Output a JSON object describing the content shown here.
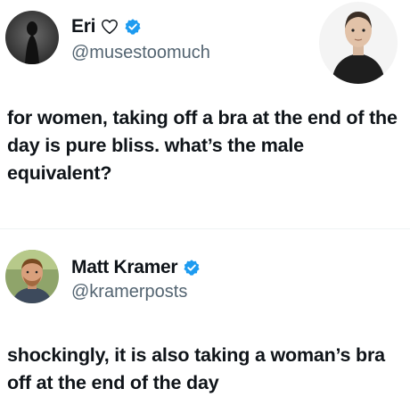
{
  "colors": {
    "verified": "#1d9bf0",
    "text": "#0f1419",
    "handle": "#536471"
  },
  "tweets": [
    {
      "display_name": "Eri",
      "name_icon": "heart-outline-icon",
      "verified_icon": "verified-badge-icon",
      "handle": "@musestoomuch",
      "text": "for women, taking off a bra at the end of the day is pure bliss. what’s the male equivalent?"
    },
    {
      "display_name": "Matt Kramer",
      "verified_icon": "verified-badge-icon",
      "handle": "@kramerposts",
      "text": "shockingly, it is also taking a woman’s bra off at the end of the day"
    }
  ]
}
